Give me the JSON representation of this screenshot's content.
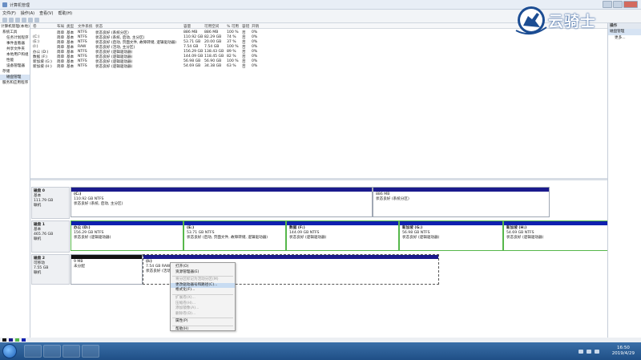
{
  "window": {
    "title": "计算机管理"
  },
  "menu": [
    "文件(F)",
    "操作(A)",
    "查看(V)",
    "帮助(H)"
  ],
  "tree": [
    "计算机管理(本地)",
    "系统工具",
    "任务计划程序",
    "事件查看器",
    "共享文件夹",
    "本地用户和组",
    "性能",
    "设备管理器",
    "存储",
    "磁盘管理",
    "服务和应用程序"
  ],
  "volume_table": {
    "headers": [
      "卷",
      "布局",
      "类型",
      "文件系统",
      "状态",
      "容量",
      "可用空间",
      "% 可用",
      "容错",
      "开销"
    ],
    "rows": [
      [
        "",
        "简单",
        "基本",
        "NTFS",
        "状态良好 (系统分区)",
        "886 MB",
        "886 MB",
        "100 %",
        "否",
        "0%"
      ],
      [
        "(C:)",
        "简单",
        "基本",
        "NTFS",
        "状态良好 (系统, 启动, 主分区)",
        "110.92 GB",
        "82.29 GB",
        "74 %",
        "否",
        "0%"
      ],
      [
        "(E:)",
        "简单",
        "基本",
        "NTFS",
        "状态良好 (启动, 页面文件, 故障转储, 逻辑驱动器)",
        "53.71 GB",
        "20.00 GB",
        "37 %",
        "否",
        "0%"
      ],
      [
        "(I:)",
        "简单",
        "基本",
        "RAW",
        "状态良好 (活动, 主分区)",
        "7.54 GB",
        "7.54 GB",
        "100 %",
        "否",
        "0%"
      ],
      [
        "办公 (D:)",
        "简单",
        "基本",
        "NTFS",
        "状态良好 (逻辑驱动器)",
        "156.29 GB",
        "138.43 GB",
        "89 %",
        "否",
        "0%"
      ],
      [
        "数据 (F:)",
        "简单",
        "基本",
        "NTFS",
        "状态良好 (逻辑驱动器)",
        "144.09 GB",
        "118.45 GB",
        "82 %",
        "否",
        "0%"
      ],
      [
        "新加坡 (G:)",
        "简单",
        "基本",
        "NTFS",
        "状态良好 (逻辑驱动器)",
        "56.98 GB",
        "56.90 GB",
        "100 %",
        "否",
        "0%"
      ],
      [
        "新加坡 (H:)",
        "简单",
        "基本",
        "NTFS",
        "状态良好 (逻辑驱动器)",
        "54.69 GB",
        "34.38 GB",
        "63 %",
        "否",
        "0%"
      ]
    ]
  },
  "disks": [
    {
      "name": "磁盘 0",
      "type": "基本",
      "size": "111.79 GB",
      "status": "联机",
      "partitions": [
        {
          "name": "(C:)",
          "size": "110.92 GB NTFS",
          "status": "状态良好 (系统, 启动, 主分区)"
        },
        {
          "name": "",
          "size": "886 MB",
          "status": "状态良好 (系统分区)"
        }
      ]
    },
    {
      "name": "磁盘 1",
      "type": "基本",
      "size": "465.76 GB",
      "status": "联机",
      "partitions": [
        {
          "name": "办公 (D:)",
          "size": "156.29 GB NTFS",
          "status": "状态良好 (逻辑驱动器)"
        },
        {
          "name": "(E:)",
          "size": "53.71 GB NTFS",
          "status": "状态良好 (启动, 页面文件, 故障转储, 逻辑驱动器)"
        },
        {
          "name": "数据 (F:)",
          "size": "144.09 GB NTFS",
          "status": "状态良好 (逻辑驱动器)"
        },
        {
          "name": "新加坡 (G:)",
          "size": "56.98 GB NTFS",
          "status": "状态良好 (逻辑驱动器)"
        },
        {
          "name": "新加坡 (H:)",
          "size": "54.69 GB NTFS",
          "status": "状态良好 (逻辑驱动器)"
        }
      ]
    },
    {
      "name": "磁盘 2",
      "type": "可移动",
      "size": "7.55 GB",
      "status": "联机",
      "partitions": [
        {
          "name": "",
          "size": "9 MB",
          "status": "未分配"
        },
        {
          "name": "(I:)",
          "size": "7.54 GB RAW",
          "status": "状态良好 (活动"
        }
      ]
    }
  ],
  "context_menu": {
    "items": [
      {
        "label": "打开(O)",
        "enabled": true
      },
      {
        "label": "资源管理器(E)",
        "enabled": true
      },
      {
        "sep": true
      },
      {
        "label": "将分区标记为活动分区(M)",
        "enabled": false
      },
      {
        "label": "更改驱动器号和路径(C)...",
        "enabled": true,
        "highlight": true
      },
      {
        "label": "格式化(F)...",
        "enabled": true
      },
      {
        "sep": true
      },
      {
        "label": "扩展卷(X)...",
        "enabled": false
      },
      {
        "label": "压缩卷(H)...",
        "enabled": false
      },
      {
        "label": "添加镜像(A)...",
        "enabled": false
      },
      {
        "label": "删除卷(D)...",
        "enabled": false
      },
      {
        "sep": true
      },
      {
        "label": "属性(P)",
        "enabled": true
      },
      {
        "sep": true
      },
      {
        "label": "帮助(H)",
        "enabled": true
      }
    ]
  },
  "actions_pane": {
    "header": "操作",
    "section": "磁盘管理",
    "more": "更多..."
  },
  "watermark": {
    "text": "云骑士"
  },
  "taskbar": {
    "time": "16:50",
    "date": "2019/4/29"
  }
}
